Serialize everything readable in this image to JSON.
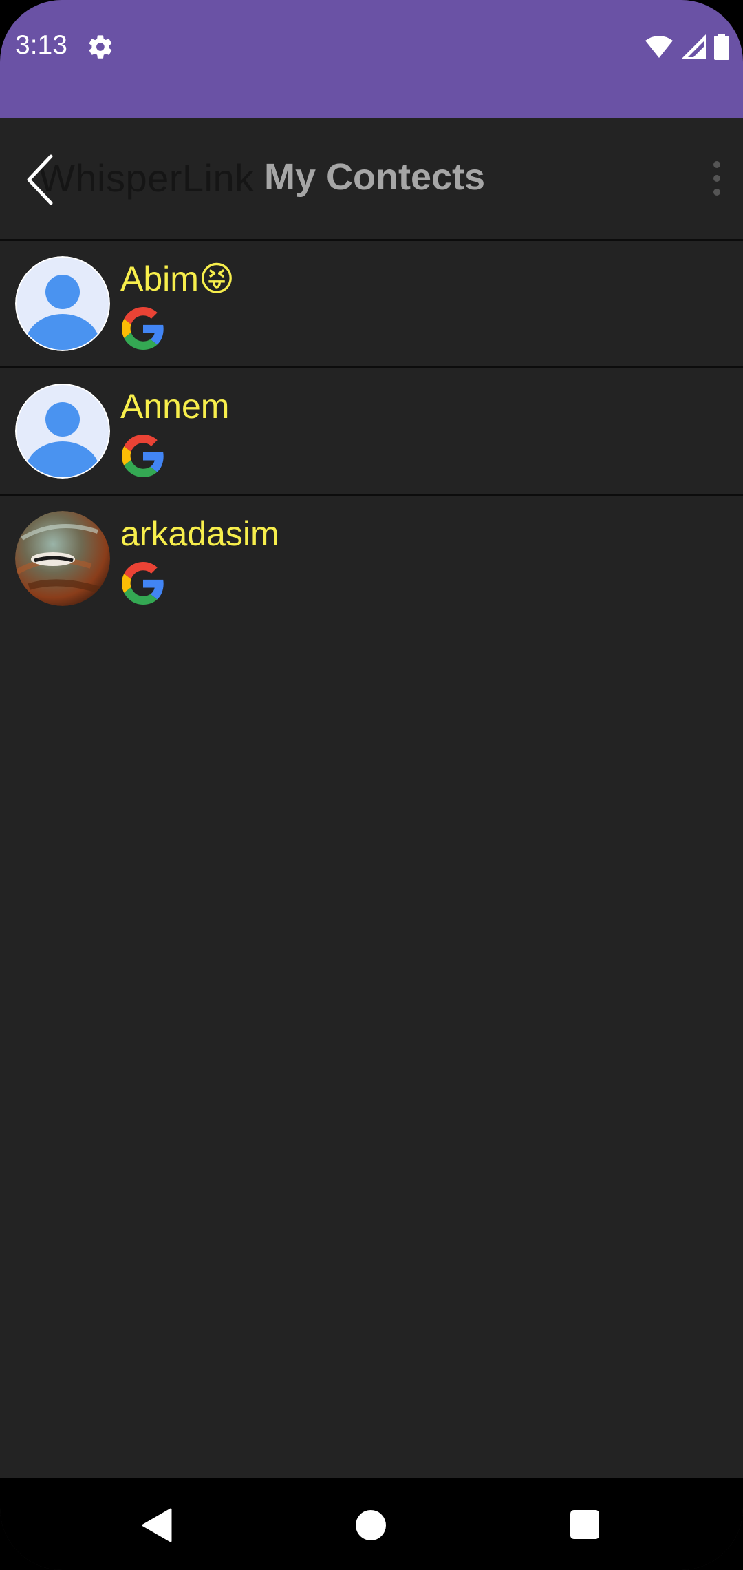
{
  "status_bar": {
    "time": "3:13",
    "background_color": "#6a52a5",
    "icons": [
      "settings-icon",
      "wifi-icon",
      "signal-icon",
      "battery-icon"
    ]
  },
  "app_bar": {
    "app_name": "WhisperLink",
    "title": "My Contects",
    "back_icon": "chevron-left-icon",
    "menu_icon": "more-vertical-icon"
  },
  "contacts": [
    {
      "name": "Abim😝",
      "avatar": "default-person-avatar",
      "source_icon": "google-icon"
    },
    {
      "name": "Annem",
      "avatar": "default-person-avatar",
      "source_icon": "google-icon"
    },
    {
      "name": "arkadasim",
      "avatar": "photo-avatar",
      "source_icon": "google-icon"
    }
  ],
  "colors": {
    "background": "#232323",
    "contact_name": "#f7ee4c",
    "title": "#a6a6a6",
    "divider": "#0c0c0c"
  },
  "nav_bar": {
    "icons": [
      "back-triangle-icon",
      "home-circle-icon",
      "recents-square-icon"
    ]
  }
}
